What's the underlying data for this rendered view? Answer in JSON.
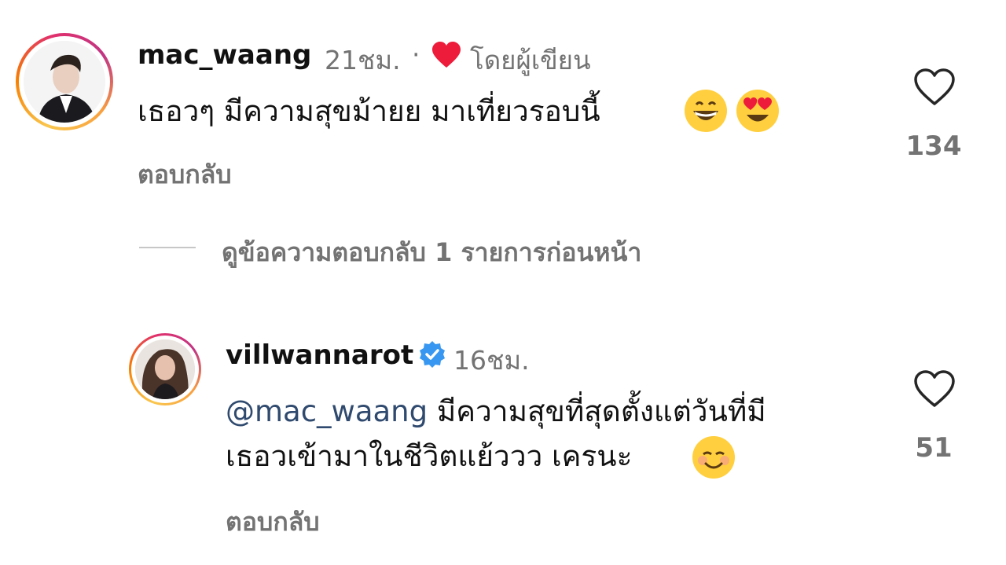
{
  "comments": [
    {
      "username": "mac_waang",
      "time": "21ชม.",
      "separator": "·",
      "liked_by_author_icon": "red-heart-icon",
      "liked_by_author_label": "โดยผู้เขียน",
      "text": "เธอวๆ มีความสุขม้ายย มาเที่ยวรอบนี้",
      "emojis": [
        "grinning-face-emoji",
        "heart-eyes-emoji"
      ],
      "reply_label": "ตอบกลับ",
      "like_count": "134"
    }
  ],
  "view_previous_replies": "ดูข้อความตอบกลับ 1 รายการก่อนหน้า",
  "reply": {
    "username": "villwannarot",
    "verified_icon": "verified-badge-icon",
    "time": "16ชม.",
    "mention": "@mac_waang",
    "text_line1": "มีความสุขที่สุดตั้งแต่วันที่มี",
    "text_line2": "เธอวเข้ามาในชีวิตแย้ววว เครนะ",
    "emojis": [
      "smiling-face-emoji"
    ],
    "reply_label": "ตอบกลับ",
    "like_count": "51"
  },
  "colors": {
    "text": "#111111",
    "secondary": "#737373",
    "mention": "#2f4a6e",
    "verified": "#3897f0",
    "heart_red": "#ed1c3b"
  }
}
